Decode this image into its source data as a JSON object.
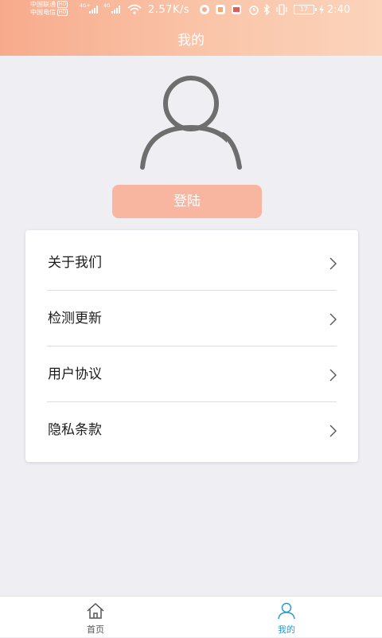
{
  "status_bar": {
    "carrier_1": "中国联通",
    "carrier_2": "中国电信",
    "hd_badge": "HD",
    "net_1": "4G+",
    "net_2": "4G",
    "speed": "2.57K/s",
    "battery": "17",
    "time": "2:40"
  },
  "header": {
    "title": "我的"
  },
  "profile": {
    "login_label": "登陆"
  },
  "menu": {
    "items": [
      {
        "label": "关于我们"
      },
      {
        "label": "检测更新"
      },
      {
        "label": "用户协议"
      },
      {
        "label": "隐私条款"
      }
    ]
  },
  "tabbar": {
    "tabs": [
      {
        "label": "首页",
        "icon": "home-icon",
        "active": false
      },
      {
        "label": "我的",
        "icon": "user-icon",
        "active": true
      }
    ]
  },
  "colors": {
    "header_start": "#f7ab8c",
    "header_end": "#fbd4bb",
    "login_button": "#f8b59f",
    "tab_active": "#2a9bd0",
    "tab_inactive": "#555555"
  }
}
